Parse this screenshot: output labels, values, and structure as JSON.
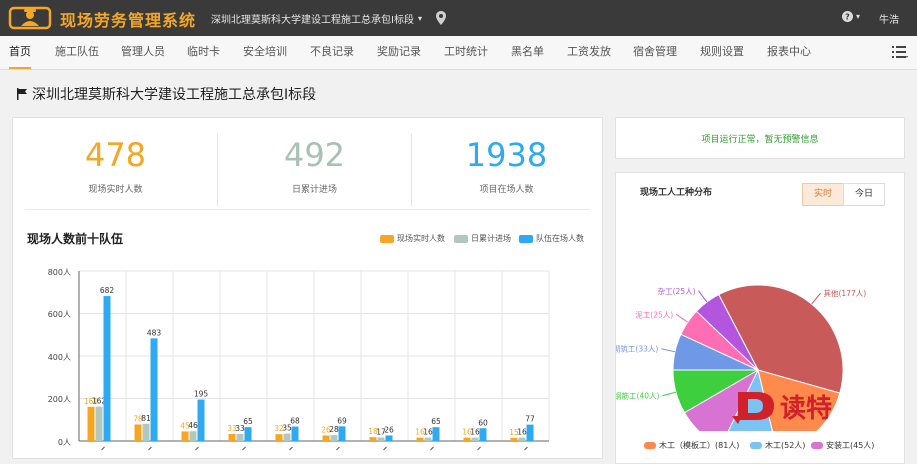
{
  "header": {
    "app_title": "现场劳务管理系统",
    "project_select": "深圳北理莫斯科大学建设工程施工总承包I标段",
    "user": "牛浩"
  },
  "nav": {
    "items": [
      "首页",
      "施工队伍",
      "管理人员",
      "临时卡",
      "安全培训",
      "不良记录",
      "奖励记录",
      "工时统计",
      "黑名单",
      "工资发放",
      "宿舍管理",
      "规则设置",
      "报表中心"
    ],
    "active": "首页"
  },
  "page_title": "深圳北理莫斯科大学建设工程施工总承包I标段",
  "stats": [
    {
      "value": "478",
      "label": "现场实时人数",
      "color": "#f5a623"
    },
    {
      "value": "492",
      "label": "日累计进场",
      "color": "#a9c1b4"
    },
    {
      "value": "1938",
      "label": "项目在场人数",
      "color": "#2ea9f2"
    }
  ],
  "bar_chart": {
    "title": "现场人数前十队伍",
    "y_ticks": [
      "800人",
      "600人",
      "400人",
      "200人",
      "0人"
    ]
  },
  "chart_data": [
    {
      "type": "bar",
      "title": "现场人数前十队伍",
      "categories": [
        "",
        "",
        "",
        "",
        "",
        "",
        "",
        "",
        "",
        ""
      ],
      "series": [
        {
          "name": "现场实时人数",
          "color": "#f5a623",
          "values": [
            161,
            78,
            45,
            33,
            32,
            26,
            18,
            16,
            16,
            15
          ]
        },
        {
          "name": "日累计进场",
          "color": "#b3c8bd",
          "values": [
            162,
            81,
            46,
            33,
            35,
            28,
            17,
            16,
            16,
            16
          ]
        },
        {
          "name": "队伍在场人数",
          "color": "#2ea9f2",
          "values": [
            682,
            483,
            195,
            65,
            68,
            69,
            26,
            65,
            60,
            77
          ]
        }
      ],
      "ylim": [
        0,
        800
      ],
      "y_tick_values": [
        0,
        200,
        400,
        600,
        800
      ],
      "grid": true,
      "legend": "top-right"
    },
    {
      "type": "pie",
      "title": "现场工人工种分布",
      "slices": [
        {
          "label": "其他(177人)",
          "value": 177,
          "color": "#c85a5a"
        },
        {
          "label": "木工（模板工）(81人)",
          "value": 81,
          "color": "#ff8a4c"
        },
        {
          "label": "木工(52人)",
          "value": 52,
          "color": "#7ac3f3"
        },
        {
          "label": "安装工(45人)",
          "value": 45,
          "color": "#d873d4"
        },
        {
          "label": "钢筋工(40人)",
          "value": 40,
          "color": "#3ecf3e"
        },
        {
          "label": "砌筑工(33人)",
          "value": 33,
          "color": "#6f98e6"
        },
        {
          "label": "泥工(25人)",
          "value": 25,
          "color": "#ff6eb4"
        },
        {
          "label": "杂工(25人)",
          "value": 25,
          "color": "#b455e0"
        }
      ],
      "legend": "bottom"
    }
  ],
  "alert": {
    "text": "项目运行正常，暂无预警信息"
  },
  "pie_panel": {
    "title": "现场工人工种分布",
    "toggle_realtime": "实时",
    "toggle_today": "今日",
    "legend": [
      {
        "label": "木工（模板工）(81人)",
        "color": "#ff8a4c"
      },
      {
        "label": "木工(52人)",
        "color": "#7ac3f3"
      },
      {
        "label": "安装工(45人)",
        "color": "#d873d4"
      }
    ]
  },
  "watermark": {
    "text": "读特"
  },
  "colors": {
    "accent": "#f5a623",
    "header_bg": "#3a3a3a"
  }
}
